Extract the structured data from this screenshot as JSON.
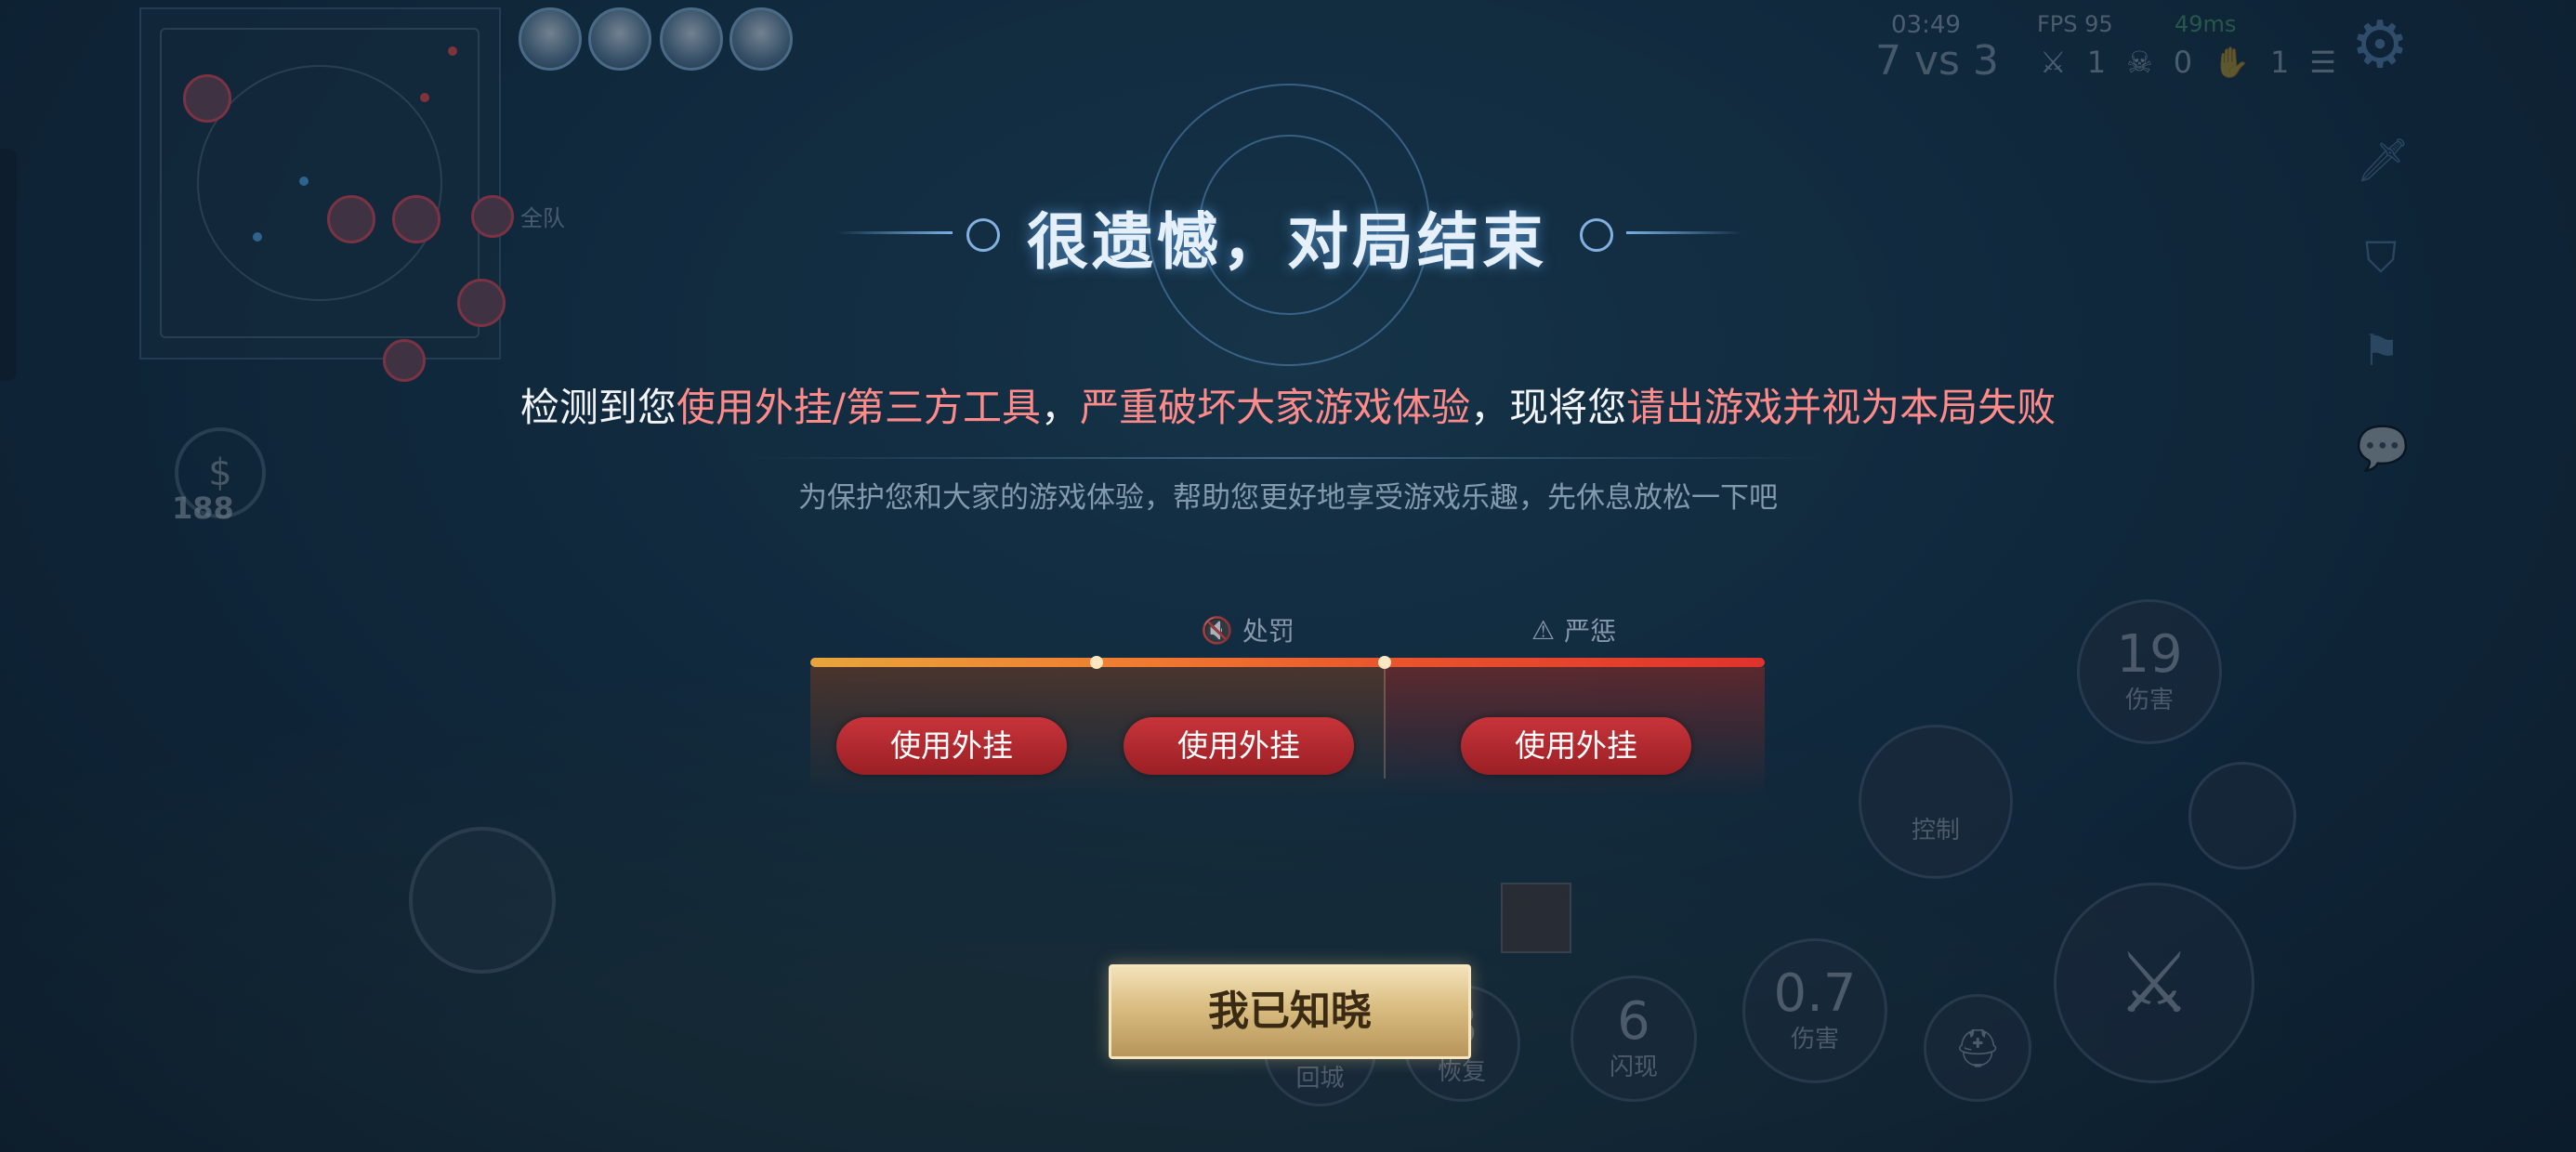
{
  "dialog": {
    "title": "很遗憾，对局结束",
    "message_parts": [
      {
        "text": "检测到您",
        "highlight": false
      },
      {
        "text": "使用外挂/第三方工具",
        "highlight": true
      },
      {
        "text": "，",
        "highlight": false
      },
      {
        "text": "严重破坏大家游戏体验",
        "highlight": true
      },
      {
        "text": "，现将您",
        "highlight": false
      },
      {
        "text": "请出游戏并视为本局失败",
        "highlight": true
      }
    ],
    "sub_message": "为保护您和大家的游戏体验，帮助您更好地享受游戏乐趣，先休息放松一下吧",
    "stage_labels": {
      "punish": "处罚",
      "severe": "严惩"
    },
    "tags": [
      "使用外挂",
      "使用外挂",
      "使用外挂"
    ],
    "ack_button": "我已知晓",
    "colors": {
      "highlight": "#ff8a8a",
      "tag": "#b3262d",
      "button": "#d9bd81"
    }
  },
  "hud": {
    "time": "03:49",
    "fps": "FPS 95",
    "ping": "49ms",
    "score": "7 vs 3",
    "kills": "1",
    "deaths": "0",
    "assists": "1",
    "gold": "188",
    "all_chat": "全队",
    "icons": [
      "gear-icon",
      "sword-icon",
      "shield-icon",
      "flag-icon",
      "chat-icon"
    ]
  },
  "skills": {
    "skill1": {
      "num": "19",
      "label": "伤害"
    },
    "skill2": {
      "label": "控制"
    },
    "skill3": {
      "num": "0.7",
      "label": "伤害"
    },
    "recall": {
      "label": "回城"
    },
    "heal": {
      "num": "3",
      "label": "恢复"
    },
    "flash": {
      "num": "6",
      "label": "闪现"
    }
  }
}
